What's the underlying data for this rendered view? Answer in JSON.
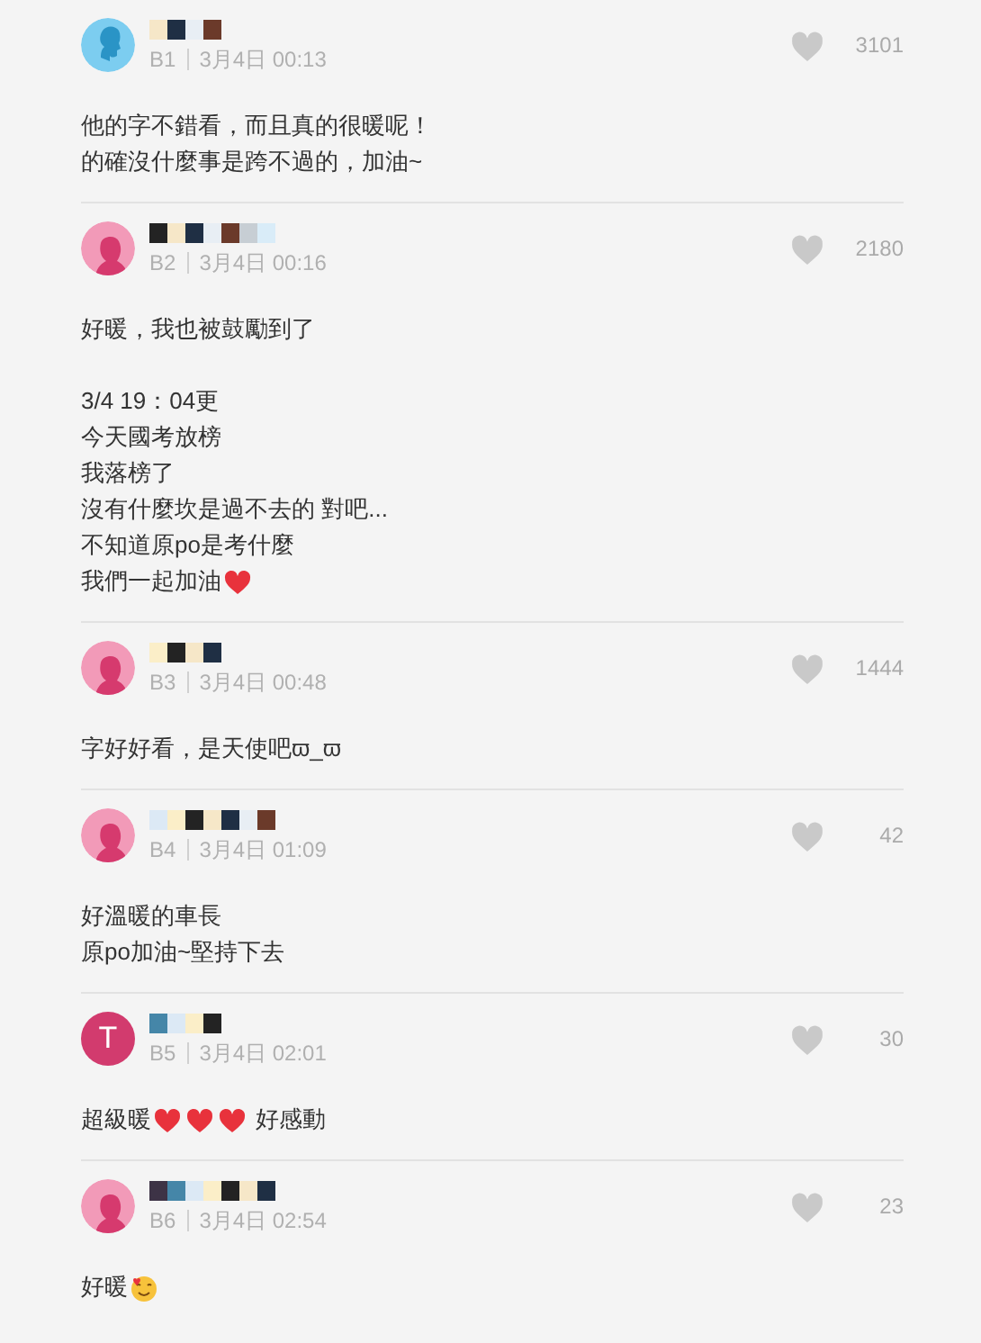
{
  "comments": [
    {
      "avatar": {
        "kind": "boy"
      },
      "floor": "B1",
      "time": "3月4日 00:13",
      "likes": "3101",
      "paragraphs": [
        [
          [
            {
              "kind": "text",
              "text": "他的字不錯看，而且真的很暖呢！"
            }
          ],
          [
            {
              "kind": "text",
              "text": "的確沒什麼事是跨不過的，加油~"
            }
          ]
        ]
      ]
    },
    {
      "avatar": {
        "kind": "girl"
      },
      "floor": "B2",
      "time": "3月4日 00:16",
      "likes": "2180",
      "paragraphs": [
        [
          [
            {
              "kind": "text",
              "text": "好暖，我也被鼓勵到了"
            }
          ]
        ],
        [
          [
            {
              "kind": "text",
              "text": "3/4 19：04更"
            }
          ],
          [
            {
              "kind": "text",
              "text": "今天國考放榜"
            }
          ],
          [
            {
              "kind": "text",
              "text": "我落榜了"
            }
          ],
          [
            {
              "kind": "text",
              "text": "沒有什麼坎是過不去的 對吧..."
            }
          ],
          [
            {
              "kind": "text",
              "text": "不知道原po是考什麼"
            }
          ],
          [
            {
              "kind": "text",
              "text": "我們一起加油"
            },
            {
              "kind": "heart"
            }
          ]
        ]
      ]
    },
    {
      "avatar": {
        "kind": "girl"
      },
      "floor": "B3",
      "time": "3月4日 00:48",
      "likes": "1444",
      "paragraphs": [
        [
          [
            {
              "kind": "text",
              "text": "字好好看，是天使吧ϖ_ϖ"
            }
          ]
        ]
      ]
    },
    {
      "avatar": {
        "kind": "girl"
      },
      "floor": "B4",
      "time": "3月4日 01:09",
      "likes": "42",
      "paragraphs": [
        [
          [
            {
              "kind": "text",
              "text": "好溫暖的車長"
            }
          ],
          [
            {
              "kind": "text",
              "text": "原po加油~堅持下去"
            }
          ]
        ]
      ]
    },
    {
      "avatar": {
        "kind": "letter",
        "letter": "T"
      },
      "floor": "B5",
      "time": "3月4日 02:01",
      "likes": "30",
      "paragraphs": [
        [
          [
            {
              "kind": "text",
              "text": "超級暖"
            },
            {
              "kind": "heart"
            },
            {
              "kind": "heart"
            },
            {
              "kind": "heart"
            },
            {
              "kind": "text",
              "text": "好感動"
            }
          ]
        ]
      ]
    },
    {
      "avatar": {
        "kind": "girl"
      },
      "floor": "B6",
      "time": "3月4日 02:54",
      "likes": "23",
      "paragraphs": [
        [
          [
            {
              "kind": "text",
              "text": "好暖"
            },
            {
              "kind": "smile"
            }
          ]
        ]
      ]
    }
  ]
}
